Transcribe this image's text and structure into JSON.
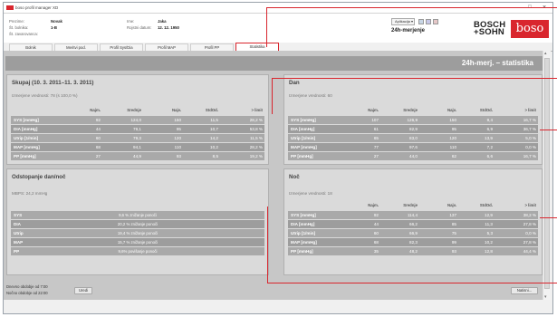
{
  "window": {
    "title": "boso profil manager XD",
    "minimize": "–",
    "maximize": "□",
    "close": "×"
  },
  "header": {
    "prezime_label": "Prezime:",
    "prezime_value": "Novak",
    "bolnica_label": "Št. bolnika:",
    "bolnica_value": "1-B",
    "zavarovanca_label": "Št. zavarovanca:",
    "ime_label": "Ime:",
    "ime_value": "Jaka",
    "rojstni_label": "Rojstni datum:",
    "rojstni_value": "12. 12. 1950",
    "aplikacija_label": "Aplikacija",
    "aplikacija_caret": "▾",
    "section_title": "24h-merjenje",
    "brand_bosch": "BOSCH",
    "brand_sohn": "+SOHN",
    "brand_boso": "boso"
  },
  "tabs": [
    "Bolnik",
    "Meritvi pod.",
    "Profil Sys/Dia",
    "Profil MAP",
    "Profil PP",
    "Statistika"
  ],
  "active_tab": 5,
  "banner_title": "24h-merj. – statistika",
  "column_headers": [
    "Najm.",
    "Srednje",
    "Najv.",
    "StdOd.",
    "> limit"
  ],
  "skupaj": {
    "title": "Skupaj (10. 3. 2011–11. 3. 2011)",
    "subtitle": "Izmerjene vrednosti: 78 (s 100,0 %)",
    "rows": [
      {
        "label": "SYS [mmHg]",
        "values": [
          "92",
          "124,0",
          "150",
          "11,5",
          "28,2 %"
        ]
      },
      {
        "label": "DIA [mmHg]",
        "values": [
          "44",
          "79,1",
          "95",
          "10,7",
          "53,8 %"
        ]
      },
      {
        "label": "Utrip [1/min]",
        "values": [
          "60",
          "79,3",
          "120",
          "14,2",
          "11,5 %"
        ]
      },
      {
        "label": "MAP [mmHg]",
        "values": [
          "68",
          "94,1",
          "110",
          "10,2",
          "28,2 %"
        ]
      },
      {
        "label": "PP [mmHg]",
        "values": [
          "27",
          "44,9",
          "93",
          "8,5",
          "19,2 %"
        ]
      }
    ]
  },
  "dan": {
    "title": "Dan",
    "subtitle": "Izmerjene vrednosti: 60",
    "rows": [
      {
        "label": "SYS [mmHg]",
        "values": [
          "107",
          "126,9",
          "150",
          "9,4",
          "16,7 %"
        ]
      },
      {
        "label": "DIA [mmHg]",
        "values": [
          "61",
          "82,9",
          "95",
          "6,9",
          "36,7 %"
        ]
      },
      {
        "label": "Utrip [1/min]",
        "values": [
          "65",
          "83,0",
          "120",
          "13,9",
          "5,0 %"
        ]
      },
      {
        "label": "MAP [mmHg]",
        "values": [
          "77",
          "97,6",
          "110",
          "7,2",
          "0,0 %"
        ]
      },
      {
        "label": "PP [mmHg]",
        "values": [
          "27",
          "44,0",
          "62",
          "6,6",
          "16,7 %"
        ]
      }
    ]
  },
  "odstopanje": {
    "title": "Odstopanje dan/noč",
    "subtitle": "MBPS: 24,2 mmHg",
    "rows": [
      {
        "label": "SYS",
        "text": "9,6 % znižanje ponoči"
      },
      {
        "label": "DIA",
        "text": "20,2 % znižanje ponoči"
      },
      {
        "label": "Utrip",
        "text": "19,4 % znižanje ponoči"
      },
      {
        "label": "MAP",
        "text": "15,7 % znižanje ponoči"
      },
      {
        "label": "PP",
        "text": "9,6% povišanje ponoči"
      }
    ]
  },
  "noc": {
    "title": "Noč",
    "subtitle": "Izmerjene vrednosti: 18",
    "rows": [
      {
        "label": "SYS [mmHg]",
        "values": [
          "92",
          "114,4",
          "137",
          "12,9",
          "38,2 %"
        ]
      },
      {
        "label": "DIA [mmHg]",
        "values": [
          "44",
          "66,2",
          "85",
          "11,3",
          "27,8 %"
        ]
      },
      {
        "label": "Utrip [1/min]",
        "values": [
          "60",
          "66,9",
          "75",
          "5,3",
          "0,0 %"
        ]
      },
      {
        "label": "MAP [mmHg]",
        "values": [
          "68",
          "82,3",
          "99",
          "10,2",
          "27,8 %"
        ]
      },
      {
        "label": "PP [mmHg]",
        "values": [
          "35",
          "48,2",
          "93",
          "12,8",
          "44,4 %"
        ]
      }
    ]
  },
  "footer": {
    "dnevno": "Dnevno obdobje od 7:00",
    "nocno": "Nočno obdobje od 22:00",
    "uredi": "Uredi",
    "natisni": "Natisni..."
  },
  "colors": {
    "accent": "#d9262e",
    "row_bg": "#a9a9a9",
    "panel_bg": "#dadada",
    "banner_bg": "#9d9d9d"
  }
}
